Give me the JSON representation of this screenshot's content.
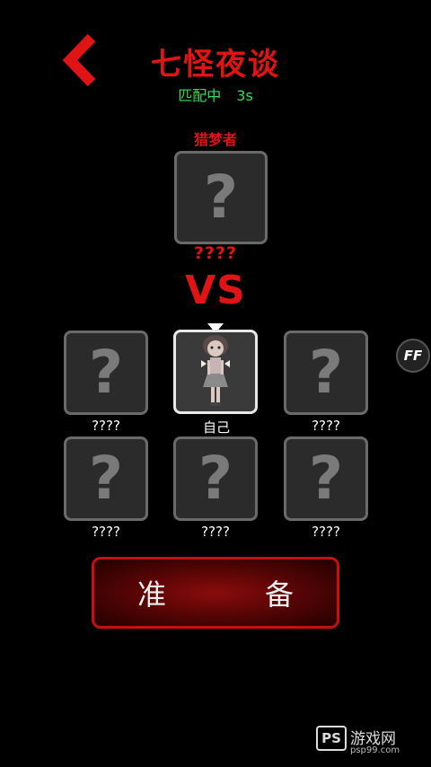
{
  "header": {
    "title": "七怪夜谈",
    "status_label": "匹配中",
    "timer": "3s"
  },
  "hunter": {
    "role_label": "猎梦者",
    "placeholder": "?",
    "name": "????"
  },
  "vs_label": "VS",
  "players": [
    {
      "name": "????",
      "placeholder": "?"
    },
    {
      "name": "自己",
      "placeholder": ""
    },
    {
      "name": "????",
      "placeholder": "?"
    },
    {
      "name": "????",
      "placeholder": "?"
    },
    {
      "name": "????",
      "placeholder": "?"
    },
    {
      "name": "????",
      "placeholder": "?"
    }
  ],
  "ff_button": "FF",
  "ready_button": {
    "left": "准",
    "right": "备"
  },
  "watermark": {
    "logo": "PS",
    "text": "游戏网",
    "url": "psp99.com"
  },
  "colors": {
    "title_red": "#e01414",
    "status_green": "#2fe04a",
    "card_border": "#6a6a6a"
  }
}
